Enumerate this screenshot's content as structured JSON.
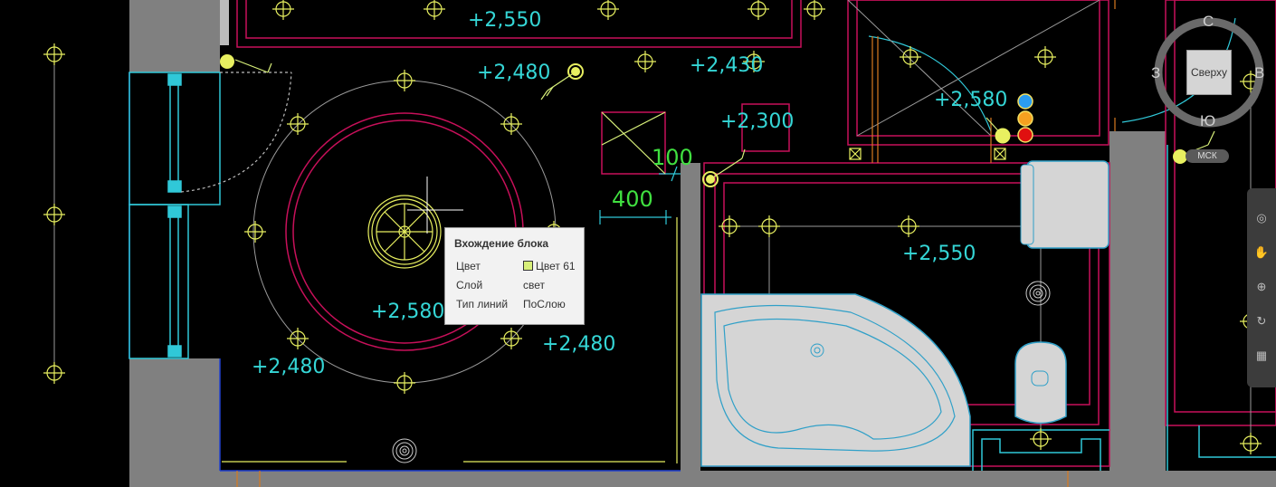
{
  "elevations": [
    "+2,550",
    "+2,480",
    "+2,430",
    "+2,300",
    "+2,580",
    "+2,550",
    "+2,580",
    "+2,480",
    "+2,480"
  ],
  "dimensions": [
    "100",
    "400"
  ],
  "tooltip": {
    "title": "Вхождение блока",
    "rows": [
      {
        "key": "Цвет",
        "value": "Цвет 61"
      },
      {
        "key": "Слой",
        "value": "свет"
      },
      {
        "key": "Тип линий",
        "value": "ПоСлою"
      }
    ],
    "swatch_color": "#d8f07a"
  },
  "viewcube": {
    "face_label": "Сверху",
    "north": "С",
    "south": "Ю",
    "west": "З",
    "east": "В"
  },
  "wcs_label": "МСК",
  "navbar": {
    "tools": [
      "steering-wheel-icon",
      "pan-icon",
      "zoom-icon",
      "orbit-icon",
      "showmotion-icon"
    ]
  },
  "colors": {
    "background": "#000000",
    "wall_fill": "#808080",
    "magenta_lines": "#c8105a",
    "cyan_lines": "#30c8d8",
    "yellow_fixtures": "#e8f060",
    "elevation_text": "#35d6d6",
    "dimension_text": "#40e040",
    "orange_lines": "#d87a20"
  }
}
